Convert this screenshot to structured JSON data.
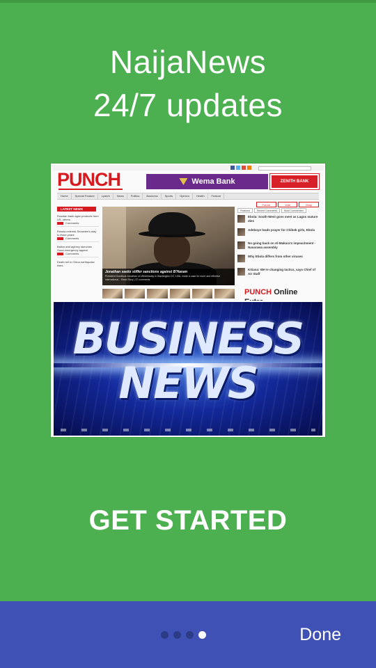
{
  "intro": {
    "title_line1": "NaijaNews",
    "title_line2": "24/7 updates"
  },
  "hero_image": {
    "site": {
      "logo": "PUNCH",
      "ad_left": "Wema Bank",
      "ad_right": "ZENITH BANK",
      "nav": [
        "Home",
        "Special Feature",
        "Lpatch",
        "News",
        "Politics",
        "Business",
        "Sports",
        "Opinion",
        "Health",
        "Feature"
      ],
      "right_tabs": [
        "Forum",
        "Vote",
        "Shop"
      ],
      "right_subtabs": [
        "Featured",
        "Recent Comments",
        "Most Commented"
      ],
      "latest_head": "LATEST NEWS",
      "latest_items": [
        "Russian bank agric products from US, others",
        "Russia extends Snowden's stay to three years",
        "Ballon and agency launches Gaza emergency appeal",
        "Death toll in China earthquake rises"
      ],
      "latest_tag_text": "Comments",
      "feature_caption_title": "Jonathan seeks stiffer sanctions against B'Haram",
      "feature_caption_text": "President Goodluck Jonathan on Wednesday in Washington DC, USA, made a case for more and effective international... Read Story | 37 comments",
      "headlines": [
        "Ebola: South-West govs meet as Lagos mature dies",
        "Adeboye leads prayer for Chibok girls, Ebola",
        "No going back on Al-Makura's impeachment - Nasarawa assembly",
        "Why Ebola differs from other viruses",
        "Kitiana: We're changing tactics, says Chief of Air Staff"
      ],
      "extra_logo_left": "PUNCH",
      "extra_logo_right": "Online Extra"
    },
    "banner": {
      "word1": "BUSINESS",
      "word2": "NEWS"
    }
  },
  "cta": {
    "label": "GET STARTED"
  },
  "footer": {
    "pager": {
      "total": 4,
      "active_index": 3
    },
    "done_label": "Done"
  },
  "colors": {
    "background": "#4CAF50",
    "bottom_bar": "#3F51B5",
    "dot_inactive": "#2c3b86",
    "dot_active": "#ffffff",
    "punch_red": "#d71920"
  }
}
